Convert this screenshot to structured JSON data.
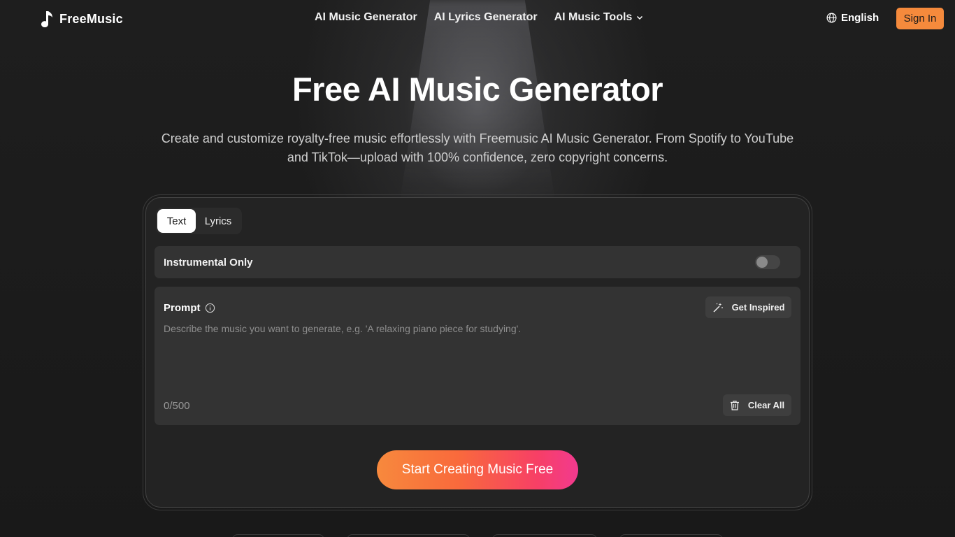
{
  "header": {
    "logo_text": "FreeMusic",
    "nav": [
      {
        "label": "AI Music Generator"
      },
      {
        "label": "AI Lyrics Generator"
      },
      {
        "label": "AI Music Tools"
      }
    ],
    "language": "English",
    "signin_label": "Sign In"
  },
  "hero": {
    "title": "Free AI Music Generator",
    "subtitle": "Create and customize royalty-free music effortlessly with Freemusic AI Music Generator. From Spotify to YouTube and TikTok—upload with 100% confidence, zero copyright concerns."
  },
  "generator": {
    "tabs": [
      {
        "label": "Text",
        "active": true
      },
      {
        "label": "Lyrics",
        "active": false
      }
    ],
    "instrumental_label": "Instrumental Only",
    "instrumental_on": false,
    "prompt_label": "Prompt",
    "get_inspired_label": "Get Inspired",
    "prompt_placeholder": "Describe the music you want to generate, e.g. 'A relaxing piano piece for studying'.",
    "prompt_value": "",
    "counter": "0/500",
    "clear_label": "Clear All",
    "cta_label": "Start Creating Music Free"
  },
  "colors": {
    "accent_orange": "#f58a3c",
    "cta_gradient_start": "#f7893d",
    "cta_gradient_end": "#f23a8f",
    "background": "#1c1c1c"
  }
}
